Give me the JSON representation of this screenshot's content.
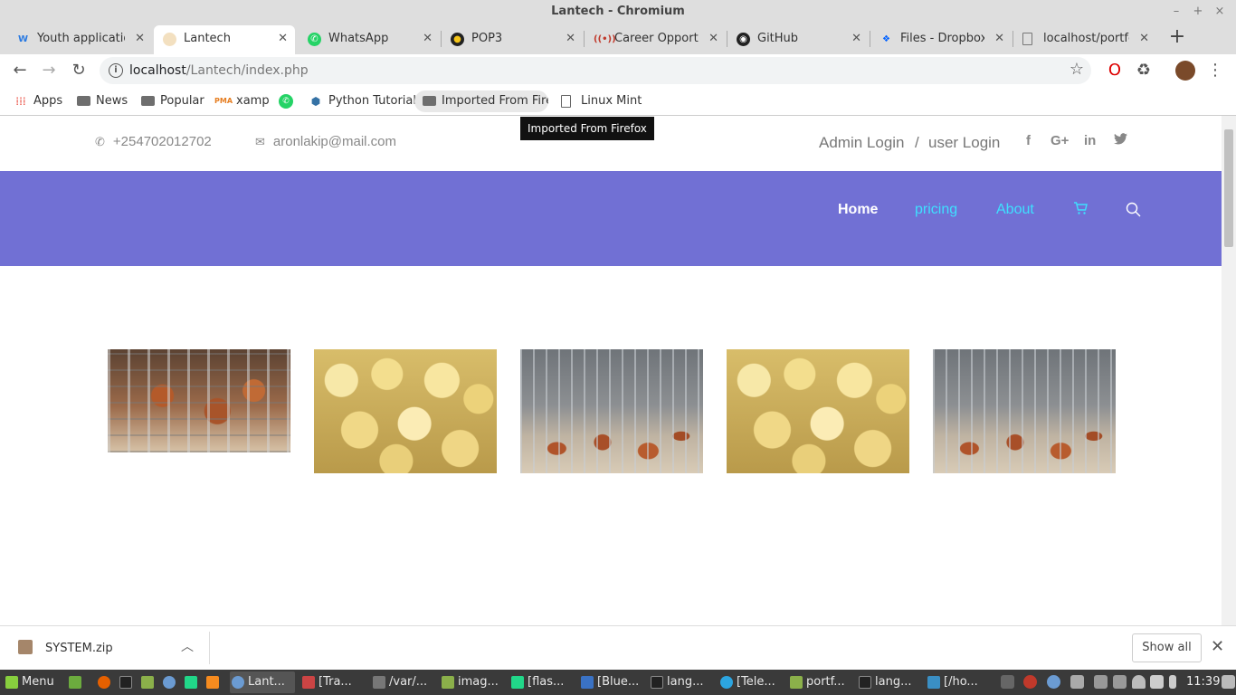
{
  "window": {
    "title": "Lantech - Chromium"
  },
  "tabs": [
    {
      "label": "Youth applications",
      "icon": "w-icon",
      "color": "#2a7ae2"
    },
    {
      "label": "Lantech",
      "icon": "page-icon",
      "color": "#e8c89a",
      "active": true
    },
    {
      "label": "WhatsApp",
      "icon": "whatsapp-icon",
      "color": "#25d366"
    },
    {
      "label": "POP3",
      "icon": "pop3-icon",
      "color": "#333"
    },
    {
      "label": "Career Opportunities",
      "icon": "career-icon",
      "color": "#c0392b"
    },
    {
      "label": "GitHub",
      "icon": "github-icon",
      "color": "#222"
    },
    {
      "label": "Files - Dropbox",
      "icon": "dropbox-icon",
      "color": "#0061ff"
    },
    {
      "label": "localhost/portfolio",
      "icon": "doc-icon",
      "color": "#777"
    }
  ],
  "address": {
    "host": "localhost",
    "path": "/Lantech/index.php"
  },
  "bookmarks": [
    {
      "label": "Apps"
    },
    {
      "label": "News"
    },
    {
      "label": "Popular"
    },
    {
      "label": "xamp"
    },
    {
      "label": ""
    },
    {
      "label": "Python Tutorial"
    },
    {
      "label": "Imported From Firef"
    },
    {
      "label": "Linux Mint"
    }
  ],
  "tooltip": "Imported From Firefox",
  "site": {
    "phone": "+254702012702",
    "email": "aronlakip@mail.com",
    "admin_login": "Admin Login",
    "separator": "/",
    "user_login": "user Login",
    "social": [
      "f",
      "G+",
      "in",
      "t"
    ],
    "nav": [
      "Home",
      "pricing",
      "About"
    ]
  },
  "download": {
    "file": "SYSTEM.zip",
    "show_all": "Show all"
  },
  "taskbar": {
    "menu": "Menu",
    "windows": [
      "Lant...",
      "[Tra...",
      "/var/...",
      "imag...",
      "[flas...",
      "[Blue...",
      "lang...",
      "[Tele...",
      "portf...",
      "lang...",
      "[/ho..."
    ],
    "clock": "11:39"
  }
}
